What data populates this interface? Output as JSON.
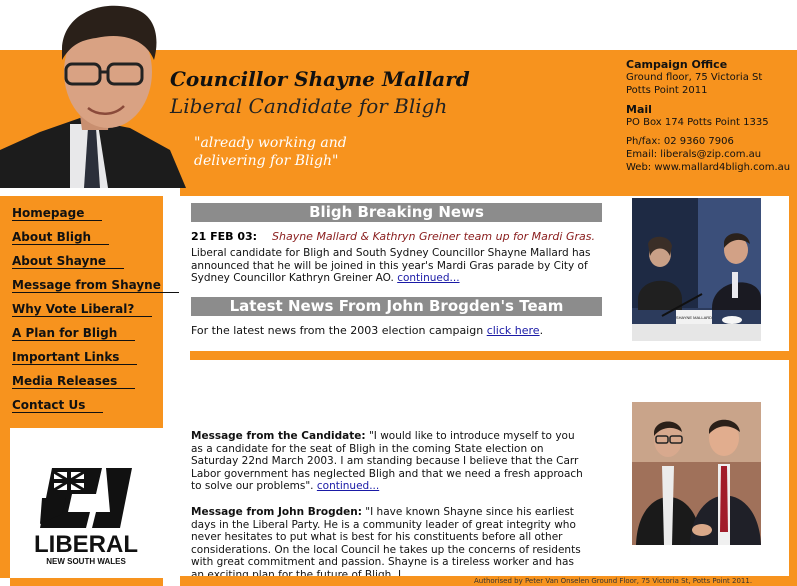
{
  "header": {
    "title": "Councillor Shayne Mallard",
    "subtitle": "Liberal Candidate for Bligh",
    "quote_line1": "\"already working and",
    "quote_line2": "delivering for Bligh\""
  },
  "contact": {
    "office_heading": "Campaign Office",
    "office_line1": "Ground floor, 75 Victoria St",
    "office_line2": "Potts Point 2011",
    "mail_heading": "Mail",
    "mail_line": "PO Box 174 Potts Point 1335",
    "phone": "Ph/fax: 02 9360 7906",
    "email": "Email: liberals@zip.com.au",
    "web": "Web: www.mallard4bligh.com.au"
  },
  "nav": {
    "items": [
      {
        "label": "Homepage"
      },
      {
        "label": "About Bligh"
      },
      {
        "label": "About Shayne"
      },
      {
        "label": "Message from Shayne"
      },
      {
        "label": "Why Vote Liberal?"
      },
      {
        "label": "A Plan for Bligh"
      },
      {
        "label": "Important Links"
      },
      {
        "label": "Media Releases"
      },
      {
        "label": "Contact Us"
      }
    ]
  },
  "logo": {
    "wordmark": "LIBERAL",
    "region": "NEW SOUTH WALES"
  },
  "breaking": {
    "heading": "Bligh Breaking News",
    "date": "21 FEB 03:",
    "headline": "Shayne Mallard & Kathryn Greiner team up for Mardi Gras.",
    "body": "Liberal candidate for Bligh and South Sydney Councillor Shayne Mallard has announced that he will be joined in this year's Mardi Gras parade by City of Sydney Councillor Kathryn Greiner AO.",
    "more_link": "continued..."
  },
  "latest": {
    "heading": "Latest News From John Brogden's Team",
    "body": "For the latest news from the 2003 election campaign",
    "link": "click here",
    "tail": "."
  },
  "messages": {
    "candidate_label": "Message from the Candidate:",
    "candidate_text": "\"I would like to introduce myself to you as a candidate for the seat of Bligh in the coming State election on Saturday 22nd March 2003. I am standing because I believe that the  Carr Labor government has neglected Bligh and that we need a fresh approach to solve our problems\".",
    "candidate_link": "continued...",
    "brogden_label": "Message from John Brogden:",
    "brogden_text": "\"I have known Shayne since his earliest days in the Liberal Party. He is a community leader of great integrity who never hesitates to put what is best for his constituents before all other considerations. On the local Council he takes up the concerns of residents with great commitment and passion. Shayne is a tireless worker and has an exciting plan for the future of Bligh. I"
  },
  "footer": {
    "authorised": "Authorised by Peter Van Onselen Ground Floor, 75 Victoria St, Potts Point 2011."
  },
  "photo_labels": {
    "nameplate": "SHAYNE MALLARD"
  },
  "colors": {
    "accent": "#F7931E",
    "bar": "#8C8C8C",
    "link": "#1a1aa6"
  }
}
